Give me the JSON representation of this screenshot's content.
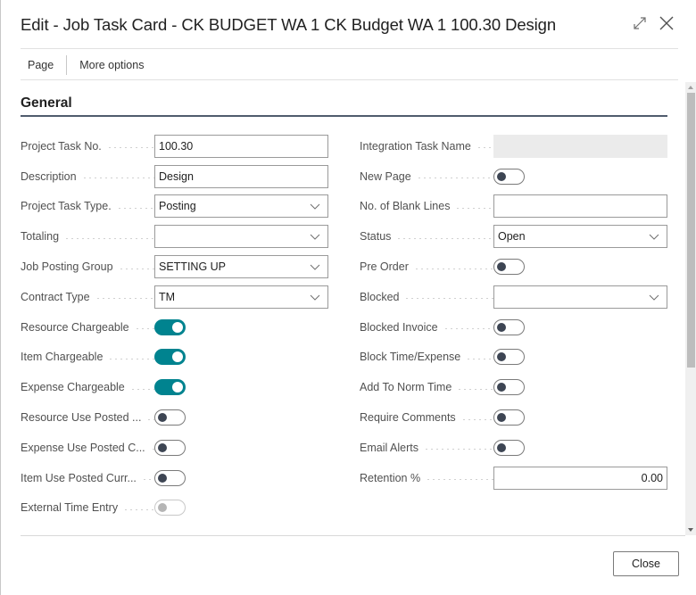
{
  "window": {
    "title": "Edit - Job Task Card - CK BUDGET WA 1 CK Budget WA 1 100.30 Design",
    "icons": [
      "expand-icon",
      "close-icon"
    ]
  },
  "action_bar": {
    "items": [
      {
        "label": "Page"
      },
      {
        "label": "More options"
      }
    ]
  },
  "section": {
    "title": "General"
  },
  "colors": {
    "toggle_on": "#00838f",
    "toggle_knob_off": "#3d4553",
    "section_underline": "#505c6d"
  },
  "left_fields": [
    {
      "label": "Project Task No.",
      "type": "text",
      "value": "100.30"
    },
    {
      "label": "Description",
      "type": "text",
      "value": "Design"
    },
    {
      "label": "Project Task Type.",
      "type": "select",
      "value": "Posting"
    },
    {
      "label": "Totaling",
      "type": "select",
      "value": ""
    },
    {
      "label": "Job Posting Group",
      "type": "select",
      "value": "SETTING UP"
    },
    {
      "label": "Contract Type",
      "type": "select",
      "value": "TM"
    },
    {
      "label": "Resource Chargeable",
      "type": "toggle",
      "value": "on"
    },
    {
      "label": "Item Chargeable",
      "type": "toggle",
      "value": "on"
    },
    {
      "label": "Expense Chargeable",
      "type": "toggle",
      "value": "on"
    },
    {
      "label": "Resource Use Posted ...",
      "type": "toggle",
      "value": "off"
    },
    {
      "label": "Expense Use Posted C...",
      "type": "toggle",
      "value": "off"
    },
    {
      "label": "Item Use Posted Curr...",
      "type": "toggle",
      "value": "off"
    },
    {
      "label": "External Time Entry",
      "type": "toggle",
      "value": "disabled"
    }
  ],
  "right_fields": [
    {
      "label": "Integration Task Name",
      "type": "readonly",
      "value": ""
    },
    {
      "label": "New Page",
      "type": "toggle",
      "value": "off"
    },
    {
      "label": "No. of Blank Lines",
      "type": "text",
      "value": ""
    },
    {
      "label": "Status",
      "type": "select",
      "value": "Open"
    },
    {
      "label": "Pre Order",
      "type": "toggle",
      "value": "off"
    },
    {
      "label": "Blocked",
      "type": "select",
      "value": ""
    },
    {
      "label": "Blocked Invoice",
      "type": "toggle",
      "value": "off"
    },
    {
      "label": "Block Time/Expense",
      "type": "toggle",
      "value": "off"
    },
    {
      "label": "Add To Norm Time",
      "type": "toggle",
      "value": "off"
    },
    {
      "label": "Require Comments",
      "type": "toggle",
      "value": "off"
    },
    {
      "label": "Email Alerts",
      "type": "toggle",
      "value": "off"
    },
    {
      "label": "Retention %",
      "type": "number",
      "value": "0.00"
    }
  ],
  "footer": {
    "close_label": "Close"
  }
}
